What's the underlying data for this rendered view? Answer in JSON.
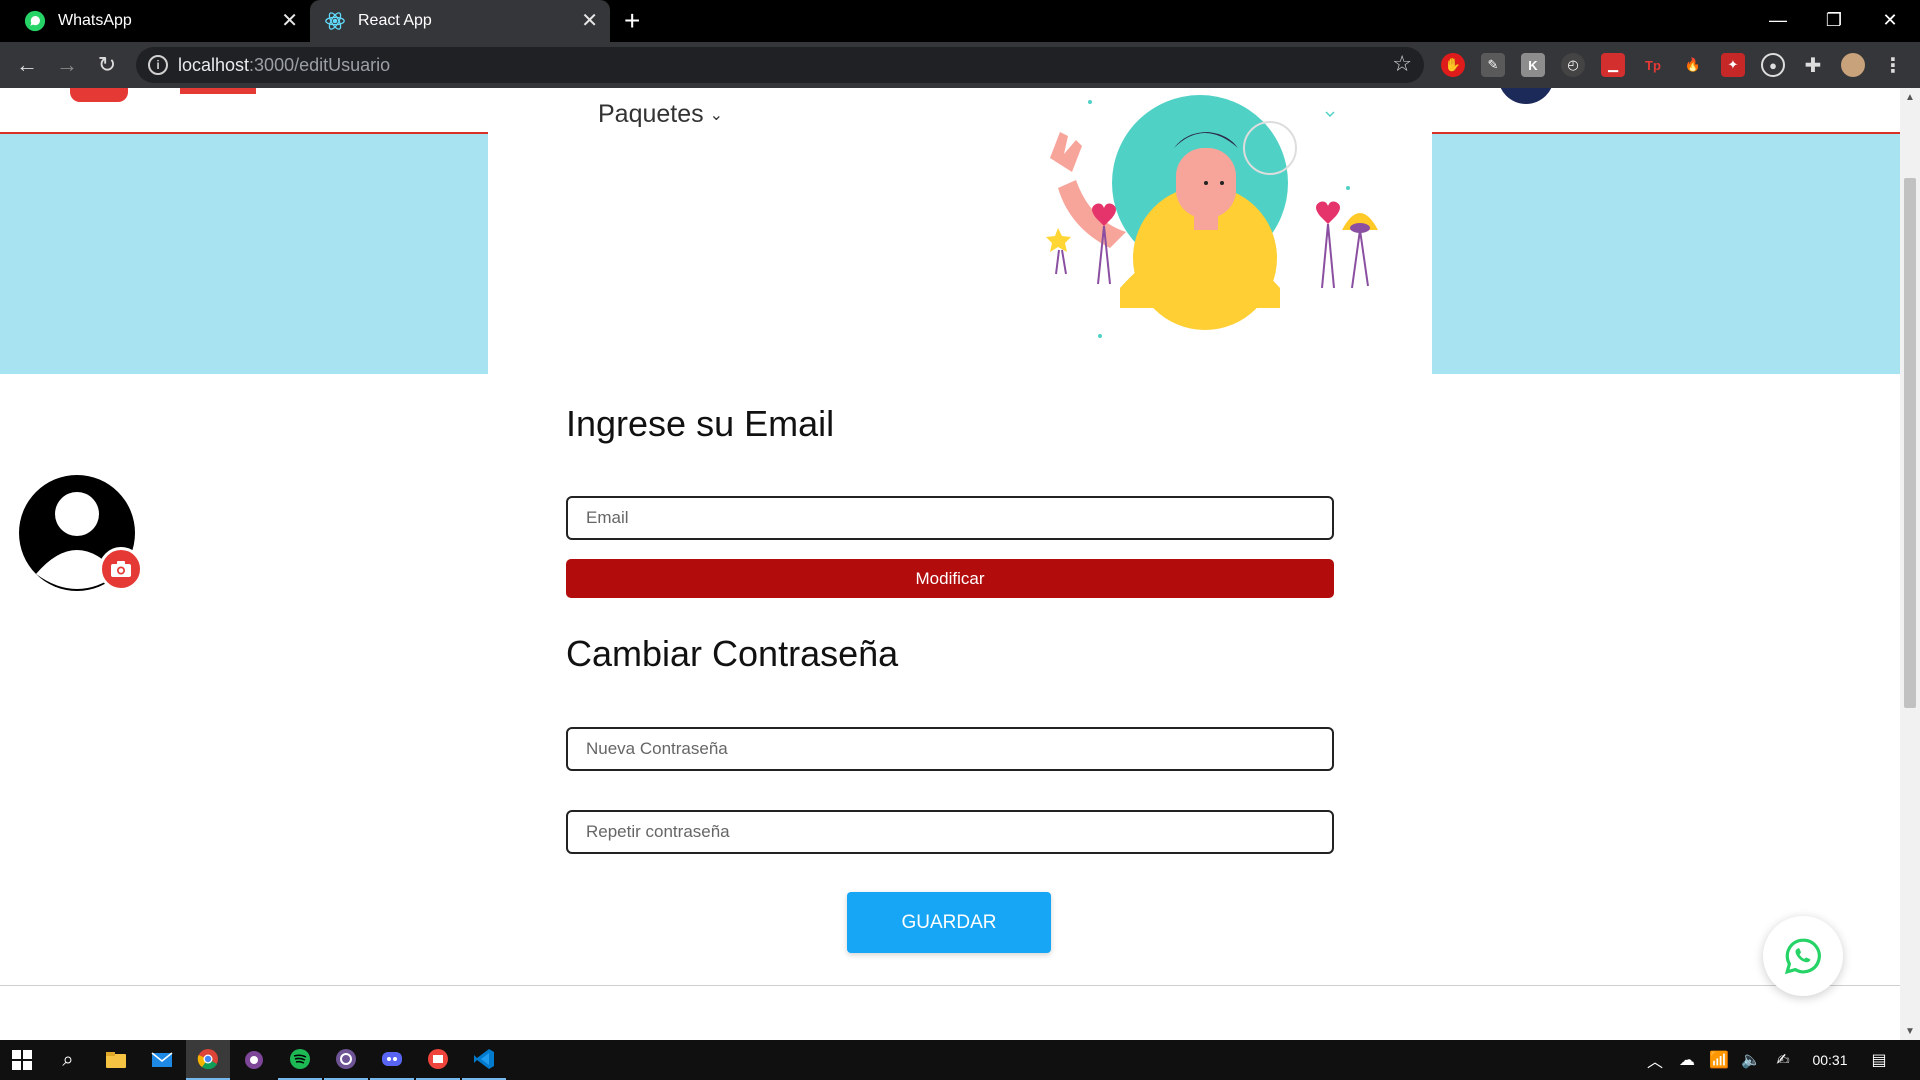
{
  "browser": {
    "tabs": [
      {
        "title": "WhatsApp",
        "icon": "whatsapp-icon",
        "active": false
      },
      {
        "title": "React App",
        "icon": "react-icon",
        "active": true
      }
    ],
    "url_host": "localhost",
    "url_path": ":3000/editUsuario"
  },
  "header": {
    "nav_item": "Paquetes"
  },
  "email_section": {
    "title": "Ingrese su Email",
    "placeholder": "Email",
    "button": "Modificar"
  },
  "password_section": {
    "title": "Cambiar Contraseña",
    "new_placeholder": "Nueva Contraseña",
    "repeat_placeholder": "Repetir contraseña",
    "button": "GUARDAR"
  },
  "taskbar": {
    "clock": "00:31"
  },
  "colors": {
    "brand_red": "#b20c0c",
    "save_blue": "#16a6f5",
    "hero_blue": "#a8e3f2",
    "whatsapp_green": "#25d366"
  }
}
